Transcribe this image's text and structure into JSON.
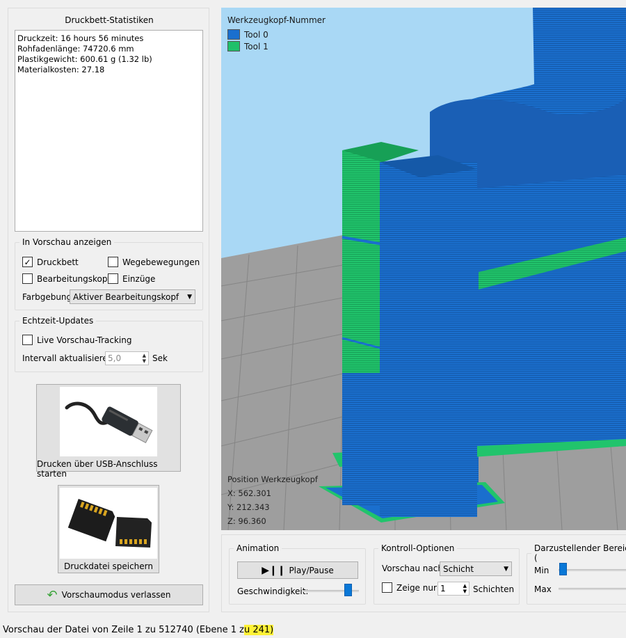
{
  "stats": {
    "title": "Druckbett-Statistiken",
    "lines": [
      "Druckzeit: 16 hours 56 minutes",
      "Rohfadenlänge: 74720.6 mm",
      "Plastikgewicht: 600.61 g (1.32 lb)",
      "Materialkosten: 27.18"
    ]
  },
  "preview": {
    "legend": "In Vorschau anzeigen",
    "druckbett": "Druckbett",
    "wegebewegungen": "Wegebewegungen",
    "bearbeitungskopf": "Bearbeitungskopf",
    "einzuege": "Einzüge",
    "farbgebung_label": "Farbgebung",
    "farbgebung_value": "Aktiver Bearbeitungskopf"
  },
  "realtime": {
    "legend": "Echtzeit-Updates",
    "live": "Live Vorschau-Tracking",
    "interval_label": "Intervall aktualisieren",
    "interval_value": "5,0",
    "interval_unit": "Sek"
  },
  "buttons": {
    "usb": "Drucken über USB-Anschluss starten",
    "save": "Druckdatei speichern",
    "exit": "Vorschaumodus verlassen"
  },
  "viewport": {
    "legend_title": "Werkzeugkopf-Nummer",
    "tools": [
      {
        "name": "Tool 0",
        "color": "#1a6fce"
      },
      {
        "name": "Tool 1",
        "color": "#1fc06a"
      }
    ],
    "pos_title": "Position Werkzeugkopf",
    "x": "X: 562.301",
    "y": "Y: 212.343",
    "z": "Z: 96.360"
  },
  "animation": {
    "legend": "Animation",
    "play": "Play/Pause",
    "speed": "Geschwindigkeit:",
    "speed_fraction": 0.85
  },
  "control": {
    "legend": "Kontroll-Optionen",
    "preview_by": "Vorschau nach",
    "preview_value": "Schicht",
    "show_only": "Zeige nur",
    "show_value": "1",
    "layers": "Schichten"
  },
  "range": {
    "legend": "Darzustellender Bereich (",
    "min": "Min",
    "max": "Max"
  },
  "status": {
    "prefix": "Vorschau der Datei von Zeile 1 zu 512740 (Ebene 1 z",
    "highlight": "u 241)"
  },
  "colors": {
    "tool0": "#1a6fce",
    "tool1": "#1fc06a",
    "sky": "#a9d8f5",
    "grid": "#8c8c8c",
    "highlight": "#fff236"
  }
}
